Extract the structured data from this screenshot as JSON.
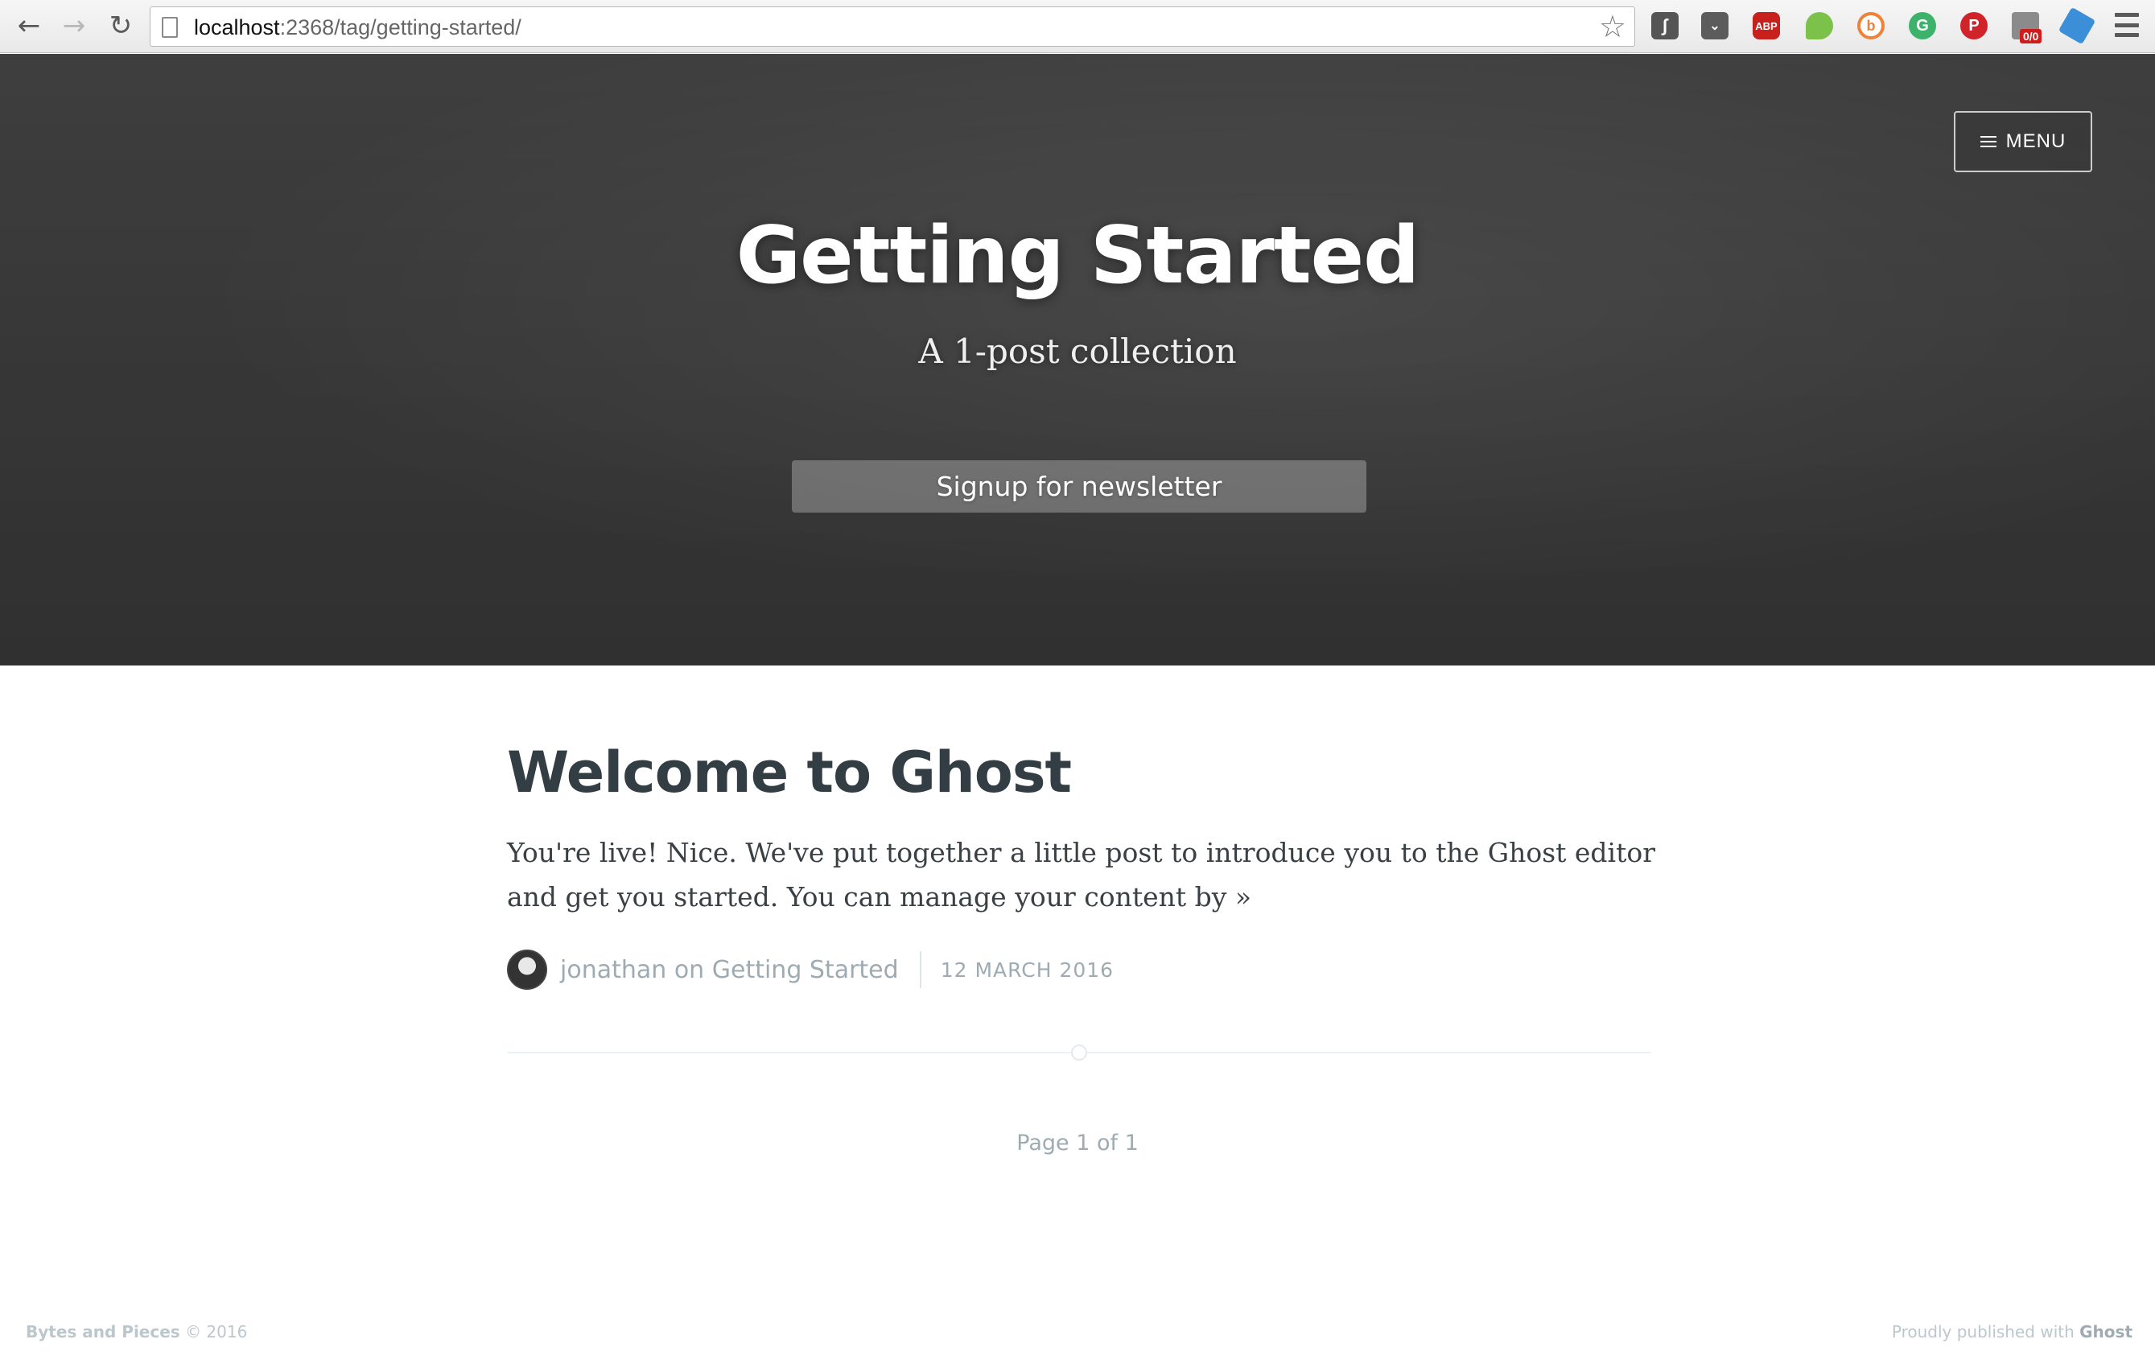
{
  "browser": {
    "url_host": "localhost",
    "url_rest": ":2368/tag/getting-started/",
    "extensions": {
      "abp_label": "ABP",
      "badge_count": "0/0"
    }
  },
  "hero": {
    "menu_label": "MENU",
    "title": "Getting Started",
    "subtitle": "A 1-post collection",
    "newsletter_label": "Signup for newsletter"
  },
  "post": {
    "title": "Welcome to Ghost",
    "excerpt": "You're live! Nice. We've put together a little post to introduce you to the Ghost editor and get you started. You can manage your content by »",
    "author": "jonathan",
    "author_tag_joiner": "on",
    "tag": "Getting Started",
    "date": "12 MARCH 2016"
  },
  "pagination": {
    "label": "Page 1 of 1"
  },
  "footer": {
    "site_name": "Bytes and Pieces",
    "copyright": "© 2016",
    "published_prefix": "Proudly published with",
    "published_brand": "Ghost"
  },
  "colors": {
    "title_text": "#333e44",
    "body_text": "#3a4145",
    "meta_text": "#9eabb3",
    "footer_text": "#bbc7cc"
  }
}
